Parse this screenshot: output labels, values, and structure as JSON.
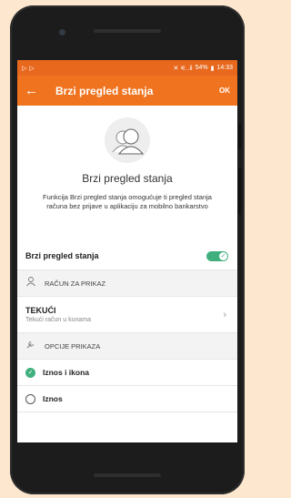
{
  "statusbar": {
    "left_icons": [
      "play-icon",
      "play-icon"
    ],
    "signal": "✕ ⚟..il",
    "battery": "54%",
    "time": "14:33"
  },
  "appbar": {
    "back_icon": "arrow-left-icon",
    "title": "Brzi pregled stanja",
    "ok_label": "OK",
    "color": "#f0741f"
  },
  "hero": {
    "icon": "user-silhouette-icon",
    "title": "Brzi pregled stanja",
    "description": "Funkcija Brzi pregled stanja omogućuje ti pregled stanja računa bez prijave u aplikaciju za mobilno bankarstvo"
  },
  "toggle_row": {
    "label": "Brzi pregled stanja",
    "enabled": true,
    "toggle_color": "#3fb07d"
  },
  "account_section": {
    "header_icon": "user-outline-icon",
    "header": "RAČUN ZA PRIKAZ",
    "account_name": "TEKUĆI",
    "account_sub": "Tekući račun u kunama",
    "chevron_icon": "chevron-right-icon"
  },
  "display_section": {
    "header_icon": "wrench-icon",
    "header": "OPCIJE PRIKAZA",
    "options": [
      {
        "label": "Iznos i ikona",
        "checked": true
      },
      {
        "label": "Iznos",
        "checked": false
      }
    ]
  }
}
